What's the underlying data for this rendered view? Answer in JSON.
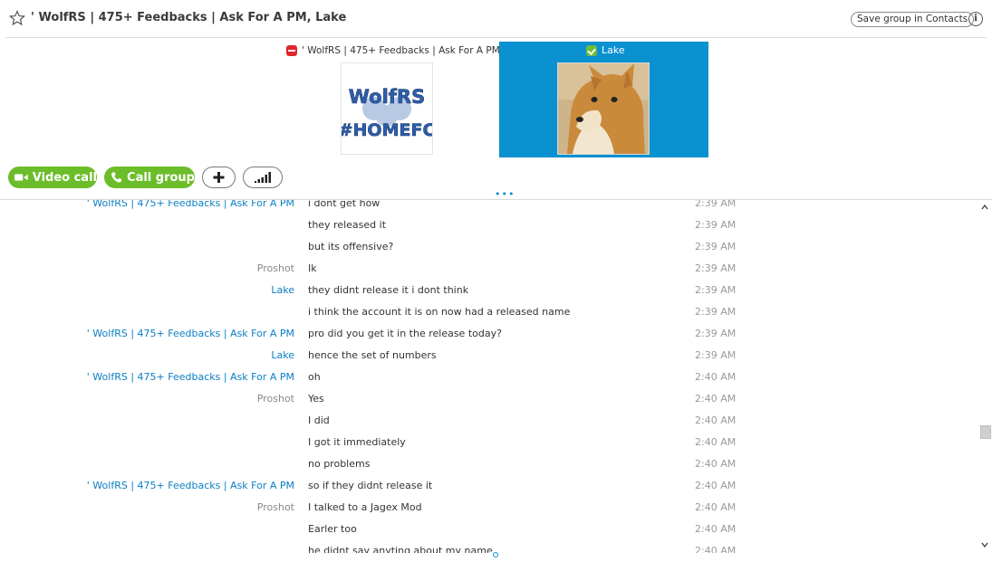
{
  "header": {
    "title": "' WolfRS | 475+ Feedbacks | Ask For A PM, Lake",
    "save_button": "Save group in Contacts",
    "info_button": "i"
  },
  "participants": [
    {
      "name": "' WolfRS | 475+ Feedbacks | Ask For A PM",
      "status": "do-not-disturb",
      "avatar_text_1": "WolfRS",
      "avatar_text_2": "#HOMEFC"
    },
    {
      "name": "Lake",
      "status": "online",
      "highlighted": true
    }
  ],
  "toolbar": {
    "video_call": "Video call",
    "call_group": "Call group",
    "add_icon": "plus-icon",
    "signal_icon": "signal-bars-icon"
  },
  "messages": [
    {
      "sender": "' WolfRS | 475+ Feedbacks | Ask For A PM",
      "sender_style": "blue",
      "text": "i dont get how",
      "time": "2:39 AM"
    },
    {
      "sender": "",
      "sender_style": "",
      "text": "they released it",
      "time": "2:39 AM"
    },
    {
      "sender": "",
      "sender_style": "",
      "text": "but its offensive?",
      "time": "2:39 AM"
    },
    {
      "sender": "Proshot",
      "sender_style": "gray",
      "text": "Ik",
      "time": "2:39 AM"
    },
    {
      "sender": "Lake",
      "sender_style": "blue",
      "text": "they didnt release it i dont think",
      "time": "2:39 AM"
    },
    {
      "sender": "",
      "sender_style": "",
      "text": "i think the account it is on now had a released name",
      "time": "2:39 AM"
    },
    {
      "sender": "' WolfRS | 475+ Feedbacks | Ask For A PM",
      "sender_style": "blue",
      "text": "pro did you get it in the release today?",
      "time": "2:39 AM"
    },
    {
      "sender": "Lake",
      "sender_style": "blue",
      "text": "hence the set of numbers",
      "time": "2:39 AM"
    },
    {
      "sender": "' WolfRS | 475+ Feedbacks | Ask For A PM",
      "sender_style": "blue",
      "text": "oh",
      "time": "2:40 AM"
    },
    {
      "sender": "Proshot",
      "sender_style": "gray",
      "text": "Yes",
      "time": "2:40 AM"
    },
    {
      "sender": "",
      "sender_style": "",
      "text": "I did",
      "time": "2:40 AM"
    },
    {
      "sender": "",
      "sender_style": "",
      "text": "I got it immediately",
      "time": "2:40 AM"
    },
    {
      "sender": "",
      "sender_style": "",
      "text": "no problems",
      "time": "2:40 AM"
    },
    {
      "sender": "' WolfRS | 475+ Feedbacks | Ask For A PM",
      "sender_style": "blue",
      "text": "so if they didnt release it",
      "time": "2:40 AM"
    },
    {
      "sender": "Proshot",
      "sender_style": "gray",
      "text": "I talked to a Jagex Mod",
      "time": "2:40 AM"
    },
    {
      "sender": "",
      "sender_style": "",
      "text": "Earler too",
      "time": "2:40 AM"
    },
    {
      "sender": "",
      "sender_style": "",
      "text": "he didnt say anyting about my name",
      "time": "2:40 AM"
    }
  ],
  "colors": {
    "accent_blue": "#0a91d0",
    "call_green": "#6cbd2a",
    "dnd_red": "#e0262b",
    "online_green": "#6cbd3b"
  }
}
